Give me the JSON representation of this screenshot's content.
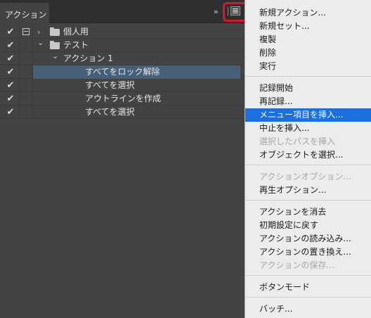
{
  "panel": {
    "tab_label": "アクション",
    "collapse_glyph": "»",
    "rows": [
      {
        "checked": true,
        "dialog": true,
        "chevron": "›",
        "folder": true,
        "label": "個人用",
        "selected": false
      },
      {
        "checked": true,
        "dialog": false,
        "chevron": "⌄",
        "folder": true,
        "label": "テスト",
        "selected": false
      },
      {
        "checked": true,
        "dialog": false,
        "chevron": "⌄",
        "folder": false,
        "label": "アクション 1",
        "selected": false
      },
      {
        "checked": true,
        "dialog": false,
        "chevron": "",
        "folder": false,
        "label": "すべてをロック解除",
        "selected": true
      },
      {
        "checked": true,
        "dialog": false,
        "chevron": "",
        "folder": false,
        "label": "すべてを選択",
        "selected": false
      },
      {
        "checked": true,
        "dialog": false,
        "chevron": "",
        "folder": false,
        "label": "アウトラインを作成",
        "selected": false
      },
      {
        "checked": true,
        "dialog": false,
        "chevron": "",
        "folder": false,
        "label": "すべてを選択",
        "selected": false
      }
    ]
  },
  "menu": {
    "groups": [
      [
        {
          "label": "新規アクション...",
          "enabled": true
        },
        {
          "label": "新規セット...",
          "enabled": true
        },
        {
          "label": "複製",
          "enabled": true
        },
        {
          "label": "削除",
          "enabled": true
        },
        {
          "label": "実行",
          "enabled": true
        }
      ],
      [
        {
          "label": "記録開始",
          "enabled": true
        },
        {
          "label": "再記録...",
          "enabled": true
        },
        {
          "label": "メニュー項目を挿入...",
          "enabled": true,
          "active": true
        },
        {
          "label": "中止を挿入...",
          "enabled": true
        },
        {
          "label": "選択したパスを挿入",
          "enabled": false
        },
        {
          "label": "オブジェクトを選択...",
          "enabled": true
        }
      ],
      [
        {
          "label": "アクションオプション...",
          "enabled": false
        },
        {
          "label": "再生オプション...",
          "enabled": true
        }
      ],
      [
        {
          "label": "アクションを消去",
          "enabled": true
        },
        {
          "label": "初期設定に戻す",
          "enabled": true
        },
        {
          "label": "アクションの読み込み...",
          "enabled": true
        },
        {
          "label": "アクションの置き換え...",
          "enabled": true
        },
        {
          "label": "アクションの保存...",
          "enabled": false
        }
      ],
      [
        {
          "label": "ボタンモード",
          "enabled": true
        }
      ],
      [
        {
          "label": "バッチ...",
          "enabled": true
        }
      ]
    ]
  },
  "colors": {
    "highlight": "#1b6fe0",
    "annotation": "#e3122a",
    "selected_row": "#46607a"
  }
}
